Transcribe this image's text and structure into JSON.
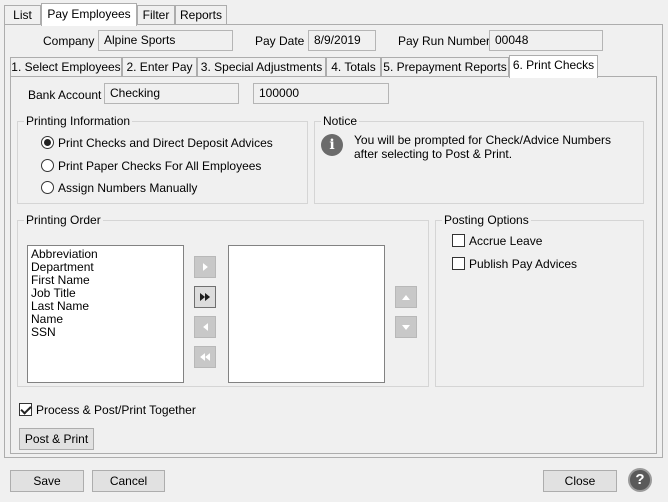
{
  "top_tabs": [
    "List",
    "Pay Employees",
    "Filter",
    "Reports"
  ],
  "header": {
    "company_label": "Company",
    "company_value": "Alpine Sports",
    "pay_date_label": "Pay Date",
    "pay_date_value": "8/9/2019",
    "pay_run_label": "Pay Run Number",
    "pay_run_value": "00048"
  },
  "sub_tabs": [
    "1. Select Employees",
    "2. Enter Pay",
    "3. Special Adjustments",
    "4. Totals",
    "5. Prepayment Reports",
    "6. Print Checks"
  ],
  "bank": {
    "label": "Bank Account",
    "account_name": "Checking",
    "account_number": "100000"
  },
  "printing_info": {
    "title": "Printing Information",
    "options": [
      {
        "label": "Print Checks and Direct Deposit Advices",
        "checked": true
      },
      {
        "label": "Print Paper Checks For All Employees",
        "checked": false
      },
      {
        "label": "Assign Numbers Manually",
        "checked": false
      }
    ]
  },
  "notice": {
    "title": "Notice",
    "line1": "You will be prompted for Check/Advice Numbers",
    "line2": "after selecting to Post & Print."
  },
  "printing_order": {
    "title": "Printing Order",
    "available": [
      "Abbreviation",
      "Department",
      "First Name",
      "Job Title",
      "Last Name",
      "Name",
      "SSN"
    ],
    "selected": []
  },
  "posting_options": {
    "title": "Posting Options",
    "accrue_leave": "Accrue Leave",
    "publish_pay_advices": "Publish Pay Advices"
  },
  "process_together": {
    "label": "Process & Post/Print Together",
    "checked": true
  },
  "post_print_button": "Post & Print",
  "footer": {
    "save": "Save",
    "cancel": "Cancel",
    "close": "Close",
    "help": "?"
  }
}
